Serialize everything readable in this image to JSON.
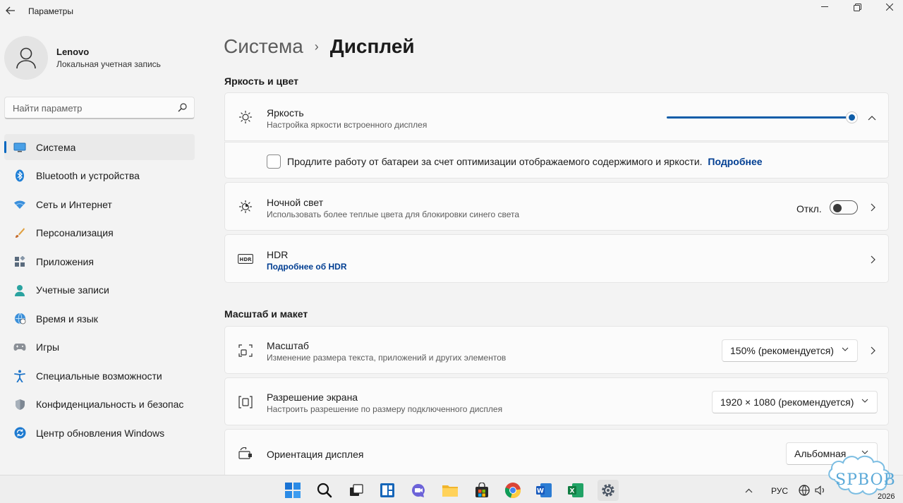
{
  "window": {
    "title": "Параметры"
  },
  "user": {
    "name": "Lenovo",
    "account_type": "Локальная учетная запись"
  },
  "search": {
    "placeholder": "Найти параметр"
  },
  "sidebar": {
    "items": [
      {
        "label": "Система",
        "icon": "monitor-icon",
        "active": true
      },
      {
        "label": "Bluetooth и устройства",
        "icon": "bluetooth-icon"
      },
      {
        "label": "Сеть и Интернет",
        "icon": "wifi-icon"
      },
      {
        "label": "Персонализация",
        "icon": "brush-icon"
      },
      {
        "label": "Приложения",
        "icon": "apps-icon"
      },
      {
        "label": "Учетные записи",
        "icon": "person-icon"
      },
      {
        "label": "Время и язык",
        "icon": "globe-clock-icon"
      },
      {
        "label": "Игры",
        "icon": "gamepad-icon"
      },
      {
        "label": "Специальные возможности",
        "icon": "accessibility-icon"
      },
      {
        "label": "Конфиденциальность и безопасность",
        "icon": "shield-icon"
      },
      {
        "label": "Центр обновления Windows",
        "icon": "update-icon"
      }
    ]
  },
  "breadcrumb": {
    "parent": "Система",
    "separator": "›",
    "current": "Дисплей"
  },
  "sections": {
    "brightness_color": "Яркость и цвет",
    "scale_layout": "Масштаб и макет"
  },
  "brightness": {
    "title": "Яркость",
    "subtitle": "Настройка яркости встроенного дисплея",
    "level": 1.0,
    "battery_option": "Продлите работу от батареи за счет оптимизации отображаемого содержимого и яркости.",
    "battery_link": "Подробнее",
    "battery_checked": false
  },
  "night_light": {
    "title": "Ночной свет",
    "subtitle": "Использовать более теплые цвета для блокировки синего света",
    "state": "Откл."
  },
  "hdr": {
    "title": "HDR",
    "link": "Подробнее об HDR"
  },
  "scale": {
    "title": "Масштаб",
    "subtitle": "Изменение размера текста, приложений и других элементов",
    "value": "150% (рекомендуется)"
  },
  "resolution": {
    "title": "Разрешение экрана",
    "subtitle": "Настроить разрешение по размеру подключенного дисплея",
    "value": "1920 × 1080 (рекомендуется)"
  },
  "orientation": {
    "title": "Ориентация дисплея",
    "value": "Альбомная"
  },
  "taskbar": {
    "apps": [
      "start-icon",
      "search-icon",
      "task-view-icon",
      "widgets-icon",
      "teams-chat-icon",
      "file-explorer-icon",
      "store-icon",
      "chrome-icon",
      "word-icon",
      "excel-icon",
      "settings-icon"
    ],
    "language": "РУС",
    "clock_partial": "2026"
  },
  "watermark": {
    "text": "SPBOB"
  },
  "colors": {
    "accent": "#0067c0",
    "slider": "#0f5da8",
    "link": "#003e92"
  }
}
